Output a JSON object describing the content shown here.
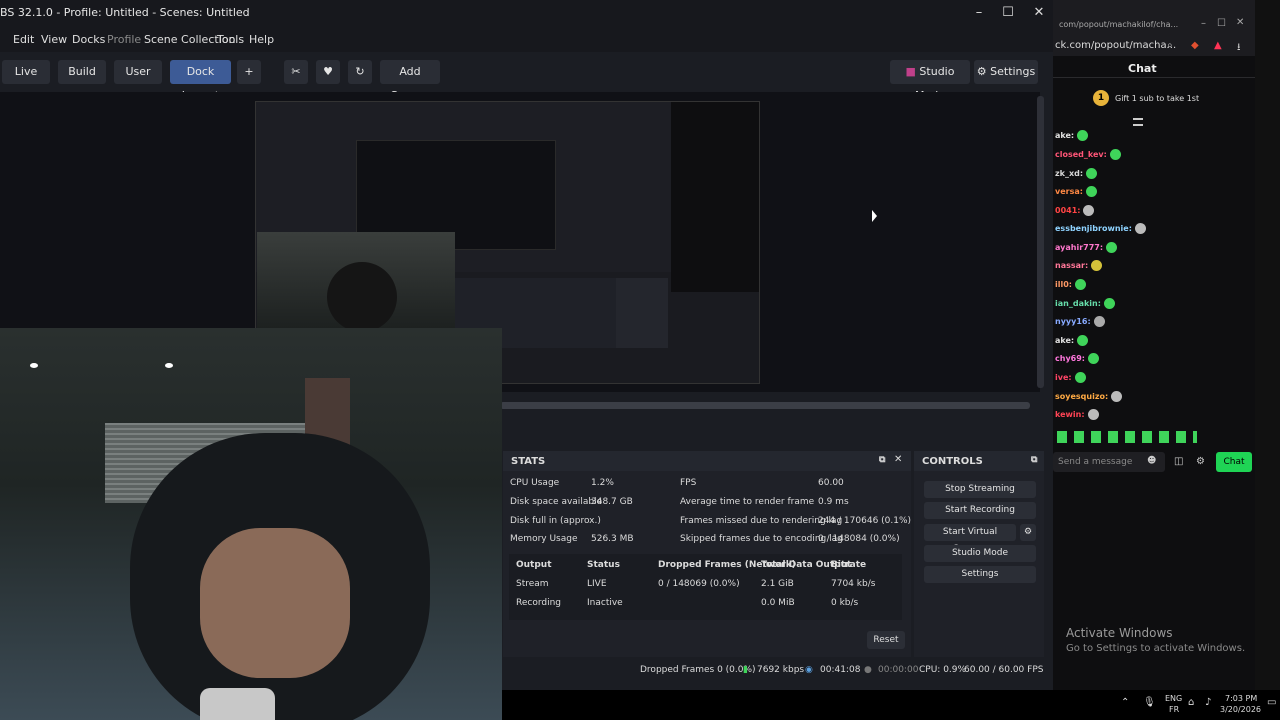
{
  "window": {
    "title": "BS 32.1.0 - Profile: Untitled - Scenes: Untitled"
  },
  "menu": [
    "Edit",
    "View",
    "Docks",
    "Profile",
    "Scene Collection",
    "Tools",
    "Help"
  ],
  "toolbar": {
    "live": "Live",
    "build": "Build",
    "user": "User",
    "dock_layout": "Dock Layout",
    "add": "+",
    "add_canvas": "Add Canvas",
    "studio_mode": "Studio Mode",
    "settings": "Settings"
  },
  "stats": {
    "title": "STATS",
    "cpu_label": "CPU Usage",
    "cpu_val": "1.2%",
    "disk_label": "Disk space available",
    "disk_val": "348.7 GB",
    "full_label": "Disk full in (approx.)",
    "mem_label": "Memory Usage",
    "mem_val": "526.3 MB",
    "fps_label": "FPS",
    "fps_val": "60.00",
    "render_label": "Average time to render frame",
    "render_val": "0.9 ms",
    "missed_label": "Frames missed due to rendering lag",
    "missed_val": "244 / 170646 (0.1%)",
    "skipped_label": "Skipped frames due to encoding lag",
    "skipped_val": "0 / 148084 (0.0%)",
    "headers": [
      "Output",
      "Status",
      "Dropped Frames (Network)",
      "Total Data Output",
      "Bitrate"
    ],
    "rows": [
      [
        "Stream",
        "LIVE",
        "0 / 148069 (0.0%)",
        "2.1 GiB",
        "7704 kb/s"
      ],
      [
        "Recording",
        "Inactive",
        "",
        "0.0 MiB",
        "0 kb/s"
      ]
    ],
    "reset": "Reset"
  },
  "controls": {
    "title": "CONTROLS",
    "stop_streaming": "Stop Streaming",
    "start_recording": "Start Recording",
    "start_virtual_camera": "Start Virtual Camera",
    "studio_mode": "Studio Mode",
    "settings": "Settings"
  },
  "statusbar": {
    "dropped": "Dropped Frames 0 (0.0%)",
    "kbps": "7692 kbps",
    "live_time": "00:41:08",
    "rec_time": "00:00:00",
    "cpu": "CPU: 0.9%",
    "fps": "60.00 / 60.00 FPS"
  },
  "chat": {
    "url": "ck.com/popout/macha...",
    "bar_title": "com/popout/machakilof/cha...",
    "title": "Chat",
    "gift": "Gift 1 sub to take 1st",
    "lines": [
      "ake:",
      "closed_kev:",
      "zk_xd:",
      "versa:",
      "0041:",
      "essbenjibrownie:",
      "ayahir777:",
      "nassar:",
      "ill0:",
      "ian_dakin:",
      "nyyy16:",
      "ake:",
      "chy69:",
      "ive:",
      "soyesquizo:",
      "kewin:"
    ],
    "input_placeholder": "Send a message",
    "chat_button": "Chat"
  },
  "watermark": {
    "line1": "Activate Windows",
    "line2": "Go to Settings to activate Windows."
  },
  "taskbar": {
    "lang1": "ENG",
    "lang2": "FR",
    "time": "7:03 PM",
    "date": "3/20/2026"
  },
  "colors": {
    "accent": "#3d5b96",
    "twitch_green": "#3fd45a",
    "chat_button": "#1fd455"
  }
}
